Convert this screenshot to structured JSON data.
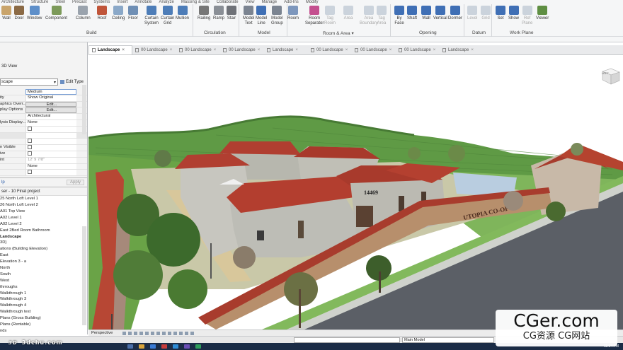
{
  "ribbon": {
    "tabs": [
      "Architecture",
      "Structure",
      "Steel",
      "Precast",
      "Systems",
      "Insert",
      "Annotate",
      "Analyze",
      "Massing & Site",
      "Collaborate",
      "View",
      "Manage",
      "Add-Ins",
      "Modify"
    ],
    "tools": [
      {
        "label": "Wall",
        "icon": "wall-icon",
        "color": "#c9a46b"
      },
      {
        "label": "Door",
        "icon": "door-icon",
        "color": "#8b6a45"
      },
      {
        "label": "Window",
        "icon": "window-icon",
        "color": "#5e8fc9"
      },
      {
        "label": "Component",
        "icon": "component-icon",
        "color": "#7c9a5a"
      },
      {
        "label": "Column",
        "icon": "column-icon",
        "color": "#9aa3ad"
      },
      {
        "label": "Roof",
        "icon": "roof-icon",
        "color": "#c0553a"
      },
      {
        "label": "Ceiling",
        "icon": "ceiling-icon",
        "color": "#8aa8c8"
      },
      {
        "label": "Floor",
        "icon": "floor-icon",
        "color": "#6f8fb5"
      },
      {
        "label": "Curtain\nSystem",
        "icon": "curtain-system-icon",
        "color": "#4d7db8"
      },
      {
        "label": "Curtain\nGrid",
        "icon": "curtain-grid-icon",
        "color": "#4d7db8"
      },
      {
        "label": "Mullion",
        "icon": "mullion-icon",
        "color": "#4d7db8"
      },
      {
        "label": "Railing",
        "icon": "railing-icon",
        "color": "#777777"
      },
      {
        "label": "Ramp",
        "icon": "ramp-icon",
        "color": "#8a8f96"
      },
      {
        "label": "Stair",
        "icon": "stair-icon",
        "color": "#6f7278"
      },
      {
        "label": "Model\nText",
        "icon": "model-text-icon",
        "color": "#7b8491"
      },
      {
        "label": "Model\nLine",
        "icon": "model-line-icon",
        "color": "#3f6fb5"
      },
      {
        "label": "Model\nGroup",
        "icon": "model-group-icon",
        "color": "#7b8491"
      },
      {
        "label": "Room",
        "icon": "room-icon",
        "color": "#7d97bd"
      },
      {
        "label": "Room\nSeparator",
        "icon": "room-separator-icon",
        "color": "#c44f8f"
      },
      {
        "label": "Tag\nRoom",
        "icon": "tag-room-icon",
        "color": "#9aa9bb"
      },
      {
        "label": "Area",
        "icon": "area-icon",
        "color": "#9aa9bb"
      },
      {
        "label": "Area\nBoundary",
        "icon": "area-boundary-icon",
        "color": "#9aa9bb"
      },
      {
        "label": "Tag\nArea",
        "icon": "tag-area-icon",
        "color": "#9aa9bb"
      },
      {
        "label": "By\nFace",
        "icon": "by-face-icon",
        "color": "#3f6fb5"
      },
      {
        "label": "Shaft",
        "icon": "shaft-icon",
        "color": "#3f6fb5"
      },
      {
        "label": "Wall",
        "icon": "opening-wall-icon",
        "color": "#3f6fb5"
      },
      {
        "label": "Vertical",
        "icon": "vertical-icon",
        "color": "#3f6fb5"
      },
      {
        "label": "Dormer",
        "icon": "dormer-icon",
        "color": "#3f6fb5"
      },
      {
        "label": "Level",
        "icon": "level-icon",
        "color": "#9aa9bb"
      },
      {
        "label": "Grid",
        "icon": "grid-icon",
        "color": "#9aa9bb"
      },
      {
        "label": "Set",
        "icon": "set-icon",
        "color": "#3f6fb5"
      },
      {
        "label": "Show",
        "icon": "show-icon",
        "color": "#3f6fb5"
      },
      {
        "label": "Ref\nPlane",
        "icon": "ref-plane-icon",
        "color": "#9aa9bb"
      },
      {
        "label": "Viewer",
        "icon": "viewer-icon",
        "color": "#5f8f43"
      }
    ],
    "panels": [
      "Build",
      "Circulation",
      "Model",
      "Room & Area ▾",
      "Opening",
      "Datum",
      "Work Plane"
    ]
  },
  "view_tabs": [
    {
      "label": "Landscape",
      "active": true
    },
    {
      "label": "00 Landscape",
      "active": false
    },
    {
      "label": "00 Landscape",
      "active": false
    },
    {
      "label": "00 Landscape",
      "active": false
    },
    {
      "label": "Landscape",
      "active": false
    },
    {
      "label": "00 Landscape",
      "active": false
    },
    {
      "label": "00 Landscape",
      "active": false
    },
    {
      "label": "00 Landscape",
      "active": false
    },
    {
      "label": "Landscape",
      "active": false
    }
  ],
  "properties": {
    "view_type": "3D View",
    "type_selector": "scape",
    "edit_type": "Edit Type",
    "rows": [
      {
        "key": "",
        "value": "Medium",
        "kind": "highlight"
      },
      {
        "key": "ity",
        "value": "Show Original",
        "kind": "text"
      },
      {
        "key": "aphics Overr...",
        "value": "Edit...",
        "kind": "button"
      },
      {
        "key": "play Options",
        "value": "Edit...",
        "kind": "button"
      },
      {
        "key": "",
        "value": "Architectural",
        "kind": "text"
      },
      {
        "key": "lysis Display...",
        "value": "None",
        "kind": "text"
      },
      {
        "key": "",
        "value": "",
        "kind": "checkbox"
      },
      {
        "key": "",
        "value": "",
        "kind": "section"
      },
      {
        "key": "",
        "value": "",
        "kind": "checkbox"
      },
      {
        "key": "n Visible",
        "value": "",
        "kind": "checkbox"
      },
      {
        "key": "ive",
        "value": "",
        "kind": "checkbox"
      },
      {
        "key": "int",
        "value": "12' 9 7/8\"",
        "kind": "dim"
      },
      {
        "key": "",
        "value": "None",
        "kind": "text"
      },
      {
        "key": "",
        "value": "",
        "kind": "checkbox"
      }
    ],
    "help_link": "lp",
    "apply": "Apply"
  },
  "browser": {
    "title": "ser - 10 Final project",
    "items": [
      {
        "label": "25 North Loft Level 1",
        "bold": false
      },
      {
        "label": "26 North Loft Level 2",
        "bold": false
      },
      {
        "label": "A01 Top View",
        "bold": false
      },
      {
        "label": "A02 Level 1",
        "bold": false
      },
      {
        "label": "A02 Level 2",
        "bold": false
      },
      {
        "label": "East 2Bed Room Bathroom",
        "bold": false
      },
      {
        "label": "Landscape",
        "bold": true
      },
      {
        "label": "3D}",
        "bold": false
      },
      {
        "label": "ations (Building Elevation)",
        "bold": false
      },
      {
        "label": "East",
        "bold": false
      },
      {
        "label": "Elevation 3 - a",
        "bold": false
      },
      {
        "label": "North",
        "bold": false
      },
      {
        "label": "South",
        "bold": false
      },
      {
        "label": "West",
        "bold": false
      },
      {
        "label": "thrroughs",
        "bold": false
      },
      {
        "label": "Walkthrough 1",
        "bold": false
      },
      {
        "label": "Walkthrough 3",
        "bold": false
      },
      {
        "label": "Walkthrough 4",
        "bold": false
      },
      {
        "label": "Walkthrough test",
        "bold": false
      },
      {
        "label": "Plans (Gross Building)",
        "bold": false
      },
      {
        "label": "Plans (Rentable)",
        "bold": false
      },
      {
        "label": "nds",
        "bold": false
      }
    ]
  },
  "scene": {
    "house_number": "14469",
    "wall_sign": "UTOPIA CO-OP",
    "viewcube_label": "LEFT"
  },
  "viewbar": {
    "mode": "Perspective"
  },
  "statusbar": {
    "field": "",
    "model": "Main Model"
  },
  "taskbar": {
    "clock": "11:04 PM"
  },
  "watermark": {
    "site": "3dchu.com",
    "logo": "3D",
    "cger": "CGer.com",
    "cger_sub": "CG资源 CG网站"
  }
}
